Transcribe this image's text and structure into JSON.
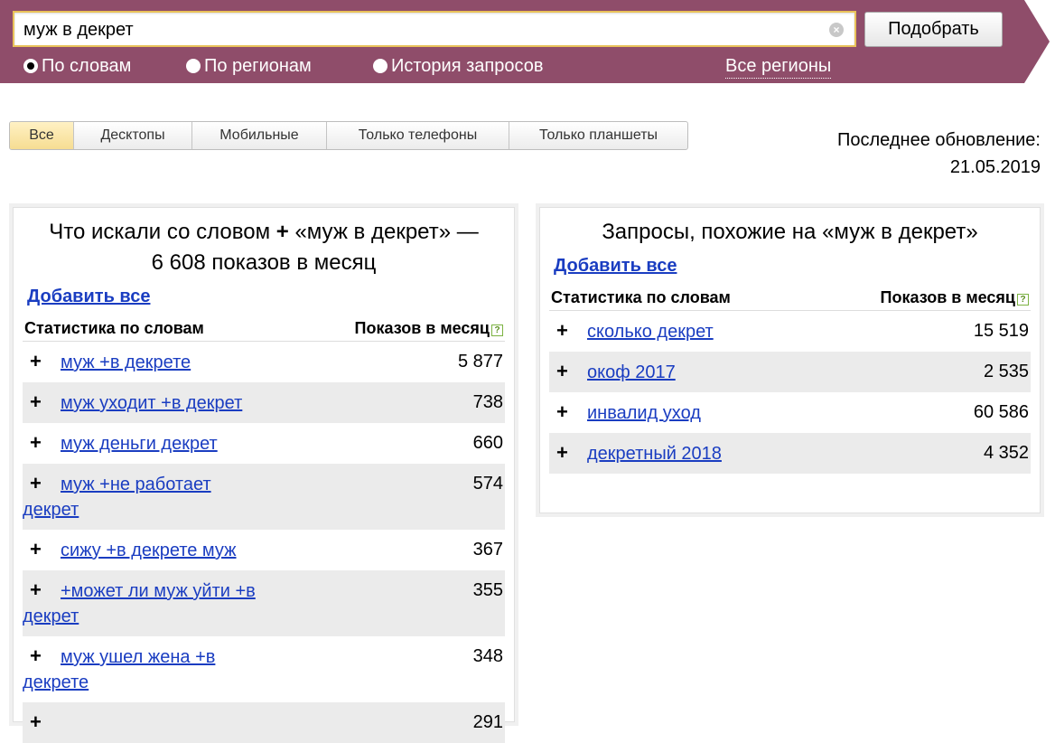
{
  "search": {
    "query": "муж в декрет",
    "submit_label": "Подобрать",
    "clear_symbol": "×"
  },
  "modes": [
    {
      "label": "По словам",
      "checked": true
    },
    {
      "label": "По регионам",
      "checked": false
    },
    {
      "label": "История запросов",
      "checked": false
    }
  ],
  "regions_link": "Все регионы",
  "device_tabs": [
    {
      "label": "Все",
      "active": true
    },
    {
      "label": "Десктопы",
      "active": false
    },
    {
      "label": "Мобильные",
      "active": false
    },
    {
      "label": "Только телефоны",
      "active": false
    },
    {
      "label": "Только планшеты",
      "active": false
    }
  ],
  "update": {
    "label": "Последнее обновление:",
    "date": "21.05.2019"
  },
  "left_panel": {
    "title_prefix": "Что искали со словом",
    "plus": "+",
    "title_suffix": "«муж в декрет» — 6 608 показов в месяц",
    "add_all": "Добавить все",
    "col_words": "Статистика по словам",
    "col_count": "Показов в месяц",
    "help_symbol": "?",
    "rows": [
      {
        "plus": "+",
        "phrase": "муж +в декрете",
        "count": "5 877"
      },
      {
        "plus": "+",
        "phrase": "муж уходит +в декрет",
        "count": "738"
      },
      {
        "plus": "+",
        "phrase": "муж деньги декрет",
        "count": "660"
      },
      {
        "plus": "+",
        "phrase": "муж +не работает декрет",
        "count": "574"
      },
      {
        "plus": "+",
        "phrase": "сижу +в декрете муж",
        "count": "367"
      },
      {
        "plus": "+",
        "phrase": "+может ли муж уйти +в декрет",
        "count": "355"
      },
      {
        "plus": "+",
        "phrase": "муж ушел жена +в декрете",
        "count": "348"
      },
      {
        "plus": "+",
        "phrase": "",
        "count": "291"
      }
    ]
  },
  "right_panel": {
    "title": "Запросы, похожие на «муж в декрет»",
    "add_all": "Добавить все",
    "col_words": "Статистика по словам",
    "col_count": "Показов в месяц",
    "help_symbol": "?",
    "rows": [
      {
        "plus": "+",
        "phrase": "сколько декрет",
        "count": "15 519"
      },
      {
        "plus": "+",
        "phrase": "окоф 2017",
        "count": "2 535"
      },
      {
        "plus": "+",
        "phrase": "инвалид уход",
        "count": "60 586"
      },
      {
        "plus": "+",
        "phrase": "декретный 2018",
        "count": "4 352"
      }
    ]
  },
  "colors": {
    "band": "#8f4d6a",
    "input_border": "#e9c25a",
    "active_tab": "#f6dd92",
    "link": "#1a3dc1",
    "row_alt": "#ebebeb"
  }
}
